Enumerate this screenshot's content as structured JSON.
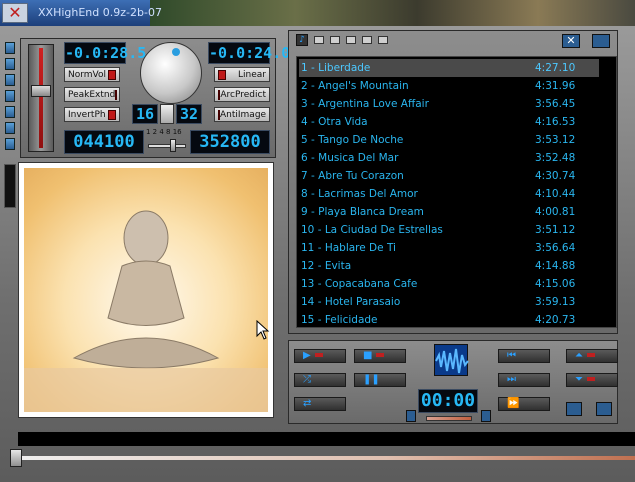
{
  "window": {
    "title": "XXHighEnd 0.9z-2b-07"
  },
  "controls": {
    "lcd_left": "-0.0:28.5",
    "lcd_right": "-0.0:24.0",
    "bits": "16",
    "bits2": "32",
    "freq_in": "044100",
    "freq_out": "352800",
    "multiplier_ticks": "1 2 4 8 16",
    "buttons": {
      "normvol": "NormVol",
      "peakextnd": "PeakExtnd",
      "invertph": "InvertPh",
      "linear": "Linear",
      "arcpredict": "ArcPredict",
      "antiimage": "AntiImage"
    }
  },
  "playlist": {
    "tracks": [
      {
        "title": "1 - Liberdade",
        "duration": "4:27.10",
        "selected": true
      },
      {
        "title": "2 - Angel's Mountain",
        "duration": "4:31.96"
      },
      {
        "title": "3 - Argentina Love Affair",
        "duration": "3:56.45"
      },
      {
        "title": "4 - Otra Vida",
        "duration": "4:16.53"
      },
      {
        "title": "5 - Tango De Noche",
        "duration": "3:53.12"
      },
      {
        "title": "6 - Musica Del Mar",
        "duration": "3:52.48"
      },
      {
        "title": "7 - Abre Tu Corazon",
        "duration": "4:30.74"
      },
      {
        "title": "8 - Lacrimas Del Amor",
        "duration": "4:10.44"
      },
      {
        "title": "9 - Playa Blanca Dream",
        "duration": "4:00.81"
      },
      {
        "title": "10 - La Ciudad De Estrellas",
        "duration": "3:51.12"
      },
      {
        "title": "11 - Hablare De Ti",
        "duration": "3:56.64"
      },
      {
        "title": "12 - Evita",
        "duration": "4:14.88"
      },
      {
        "title": "13 - Copacabana Cafe",
        "duration": "4:15.06"
      },
      {
        "title": "14 - Hotel Parasaio",
        "duration": "3:59.13"
      },
      {
        "title": "15 - Felicidade",
        "duration": "4:20.73"
      }
    ]
  },
  "transport": {
    "time": "00:00"
  },
  "colors": {
    "lcd": "#27b8f5",
    "accent": "#2ab6ef"
  }
}
